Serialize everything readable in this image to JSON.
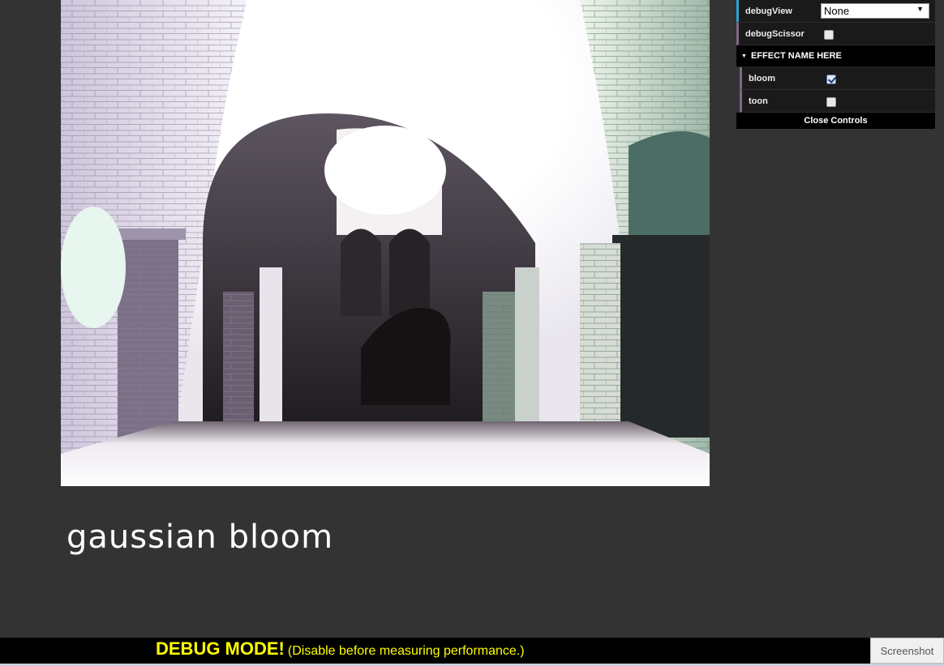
{
  "caption": "gaussian bloom",
  "gui": {
    "debugView": {
      "label": "debugView",
      "value": "None"
    },
    "debugScissor": {
      "label": "debugScissor",
      "checked": false
    },
    "folder": {
      "title": "EFFECT NAME HERE"
    },
    "bloom": {
      "label": "bloom",
      "checked": true
    },
    "toon": {
      "label": "toon",
      "checked": false
    },
    "close_label": "Close Controls"
  },
  "debug_bar": {
    "strong": "DEBUG MODE!",
    "note": "(Disable before measuring performance.)"
  },
  "screenshot_label": "Screenshot",
  "colors": {
    "background": "#333333",
    "accent_blue": "#2fa1d6",
    "accent_purple": "#806787",
    "debug_text": "#ffff00"
  }
}
